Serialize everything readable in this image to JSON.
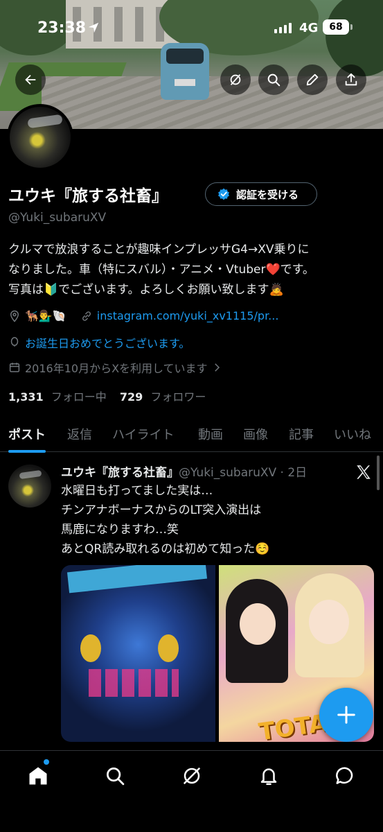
{
  "status_bar": {
    "time": "23:38",
    "network": "4G",
    "battery": "68"
  },
  "profile": {
    "name": "ユウキ『旅する社畜』",
    "verify_label": "認証を受ける",
    "handle": "@Yuki_subaruXV",
    "bio_lines": [
      "クルマで放浪することが趣味インプレッサG4→XV乗りに",
      "なりました。車（特にスバル）・アニメ・Vtuber❤️です。",
      "写真は🔰でございます。よろしくお願い致します🙇"
    ],
    "location": "🐕‍🦺💁‍♂️🐚",
    "link": "instagram.com/yuki_xv1115/pr...",
    "birthday": "お誕生日おめでとうございます。",
    "joined": "2016年10月からXを利用しています",
    "following_count": "1,331",
    "following_label": "フォロー中",
    "followers_count": "729",
    "followers_label": "フォロワー"
  },
  "tabs": [
    "ポスト",
    "返信",
    "ハイライト",
    "動画",
    "画像",
    "記事",
    "いいね"
  ],
  "post": {
    "name": "ユウキ『旅する社畜』",
    "meta": "@Yuki_subaruXV · 2日",
    "lines": [
      "水曜日も打ってました実は…",
      "チンアナボーナスからのLT突入演出は",
      "馬鹿になりますわ…笑",
      "あとQR読み取れるのは初めて知った☺️"
    ],
    "image_right_text": "TOTAL 209"
  },
  "colors": {
    "accent": "#1d9bf0",
    "background": "#000000",
    "muted": "#71767b"
  },
  "icons": {
    "back": "back-arrow-icon",
    "grok": "grok-icon",
    "search": "search-icon",
    "edit": "pencil-icon",
    "share": "share-icon",
    "verified": "verified-badge-icon",
    "location": "location-pin-icon",
    "link": "link-icon",
    "birthday": "balloon-icon",
    "calendar": "calendar-icon",
    "compose": "plus-icon",
    "nav": [
      "home-icon",
      "search-icon",
      "grok-icon",
      "bell-icon",
      "messages-icon"
    ]
  }
}
